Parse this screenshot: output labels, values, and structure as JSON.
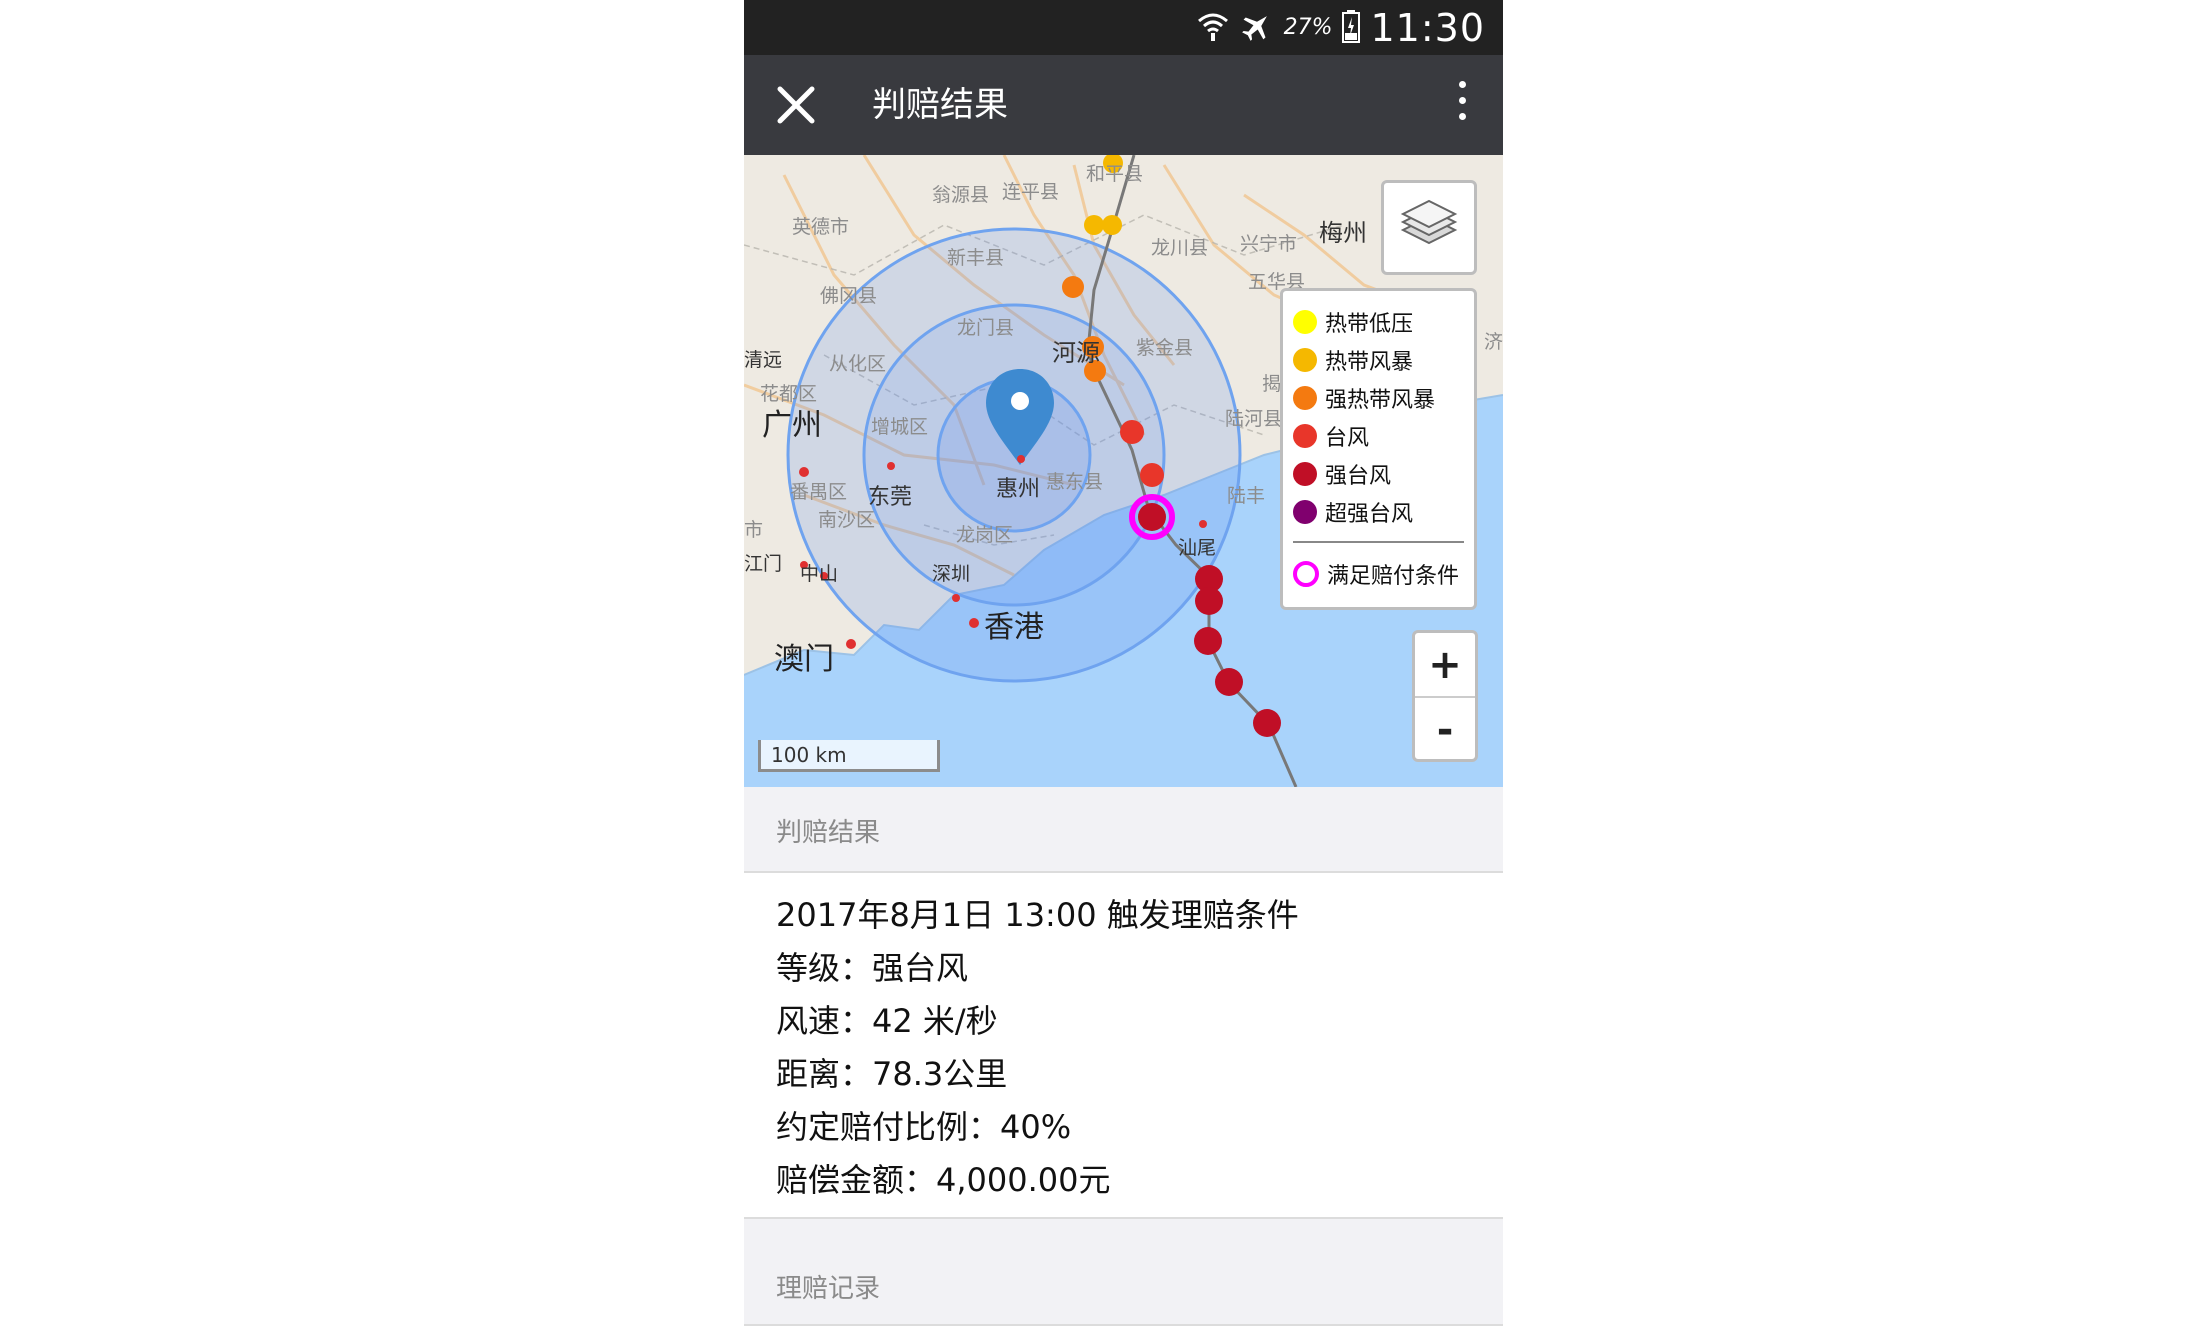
{
  "status_bar": {
    "battery_percent": "27%",
    "time": "11:30",
    "icons": [
      "wifi-icon",
      "airplane-icon",
      "battery-icon"
    ]
  },
  "app_bar": {
    "title": "判赔结果",
    "close_icon": "close-icon",
    "more_icon": "more-vertical-icon"
  },
  "map": {
    "labels": [
      "和平县",
      "翁源县",
      "连平县",
      "英德市",
      "新丰县",
      "龙川县",
      "兴宁市",
      "梅州",
      "五华县",
      "佛冈县",
      "龙门县",
      "河源",
      "紫金县",
      "清远",
      "从化区",
      "花都区",
      "揭",
      "陆河县",
      "广州",
      "增城区",
      "惠州",
      "惠东县",
      "陆丰",
      "番禺区",
      "东莞",
      "南沙区",
      "中山",
      "江门",
      "龙岗区",
      "深圳",
      "汕尾",
      "香港",
      "澳门",
      "市",
      "济"
    ],
    "scale_label": "100 km",
    "zoom_in_label": "+",
    "zoom_out_label": "-",
    "layers_icon": "layers-icon",
    "location_pin_icon": "map-pin-icon",
    "legend": [
      {
        "label": "热带低压",
        "color": "#ffff00"
      },
      {
        "label": "热带风暴",
        "color": "#f5b800"
      },
      {
        "label": "强热带风暴",
        "color": "#f47a10"
      },
      {
        "label": "台风",
        "color": "#e8362a"
      },
      {
        "label": "强台风",
        "color": "#c00f26"
      },
      {
        "label": "超强台风",
        "color": "#80006e"
      }
    ],
    "legend_condition": {
      "label": "满足赔付条件",
      "color": "#ff00ff"
    }
  },
  "result_section": {
    "header": "判赔结果",
    "lines": [
      "2017年8月1日 13:00 触发理赔条件",
      "等级：强台风",
      "风速：42 米/秒",
      "距离：78.3公里",
      "约定赔付比例：40%",
      "赔偿金额：4,000.00元"
    ]
  },
  "records_section": {
    "header": "理赔记录"
  }
}
